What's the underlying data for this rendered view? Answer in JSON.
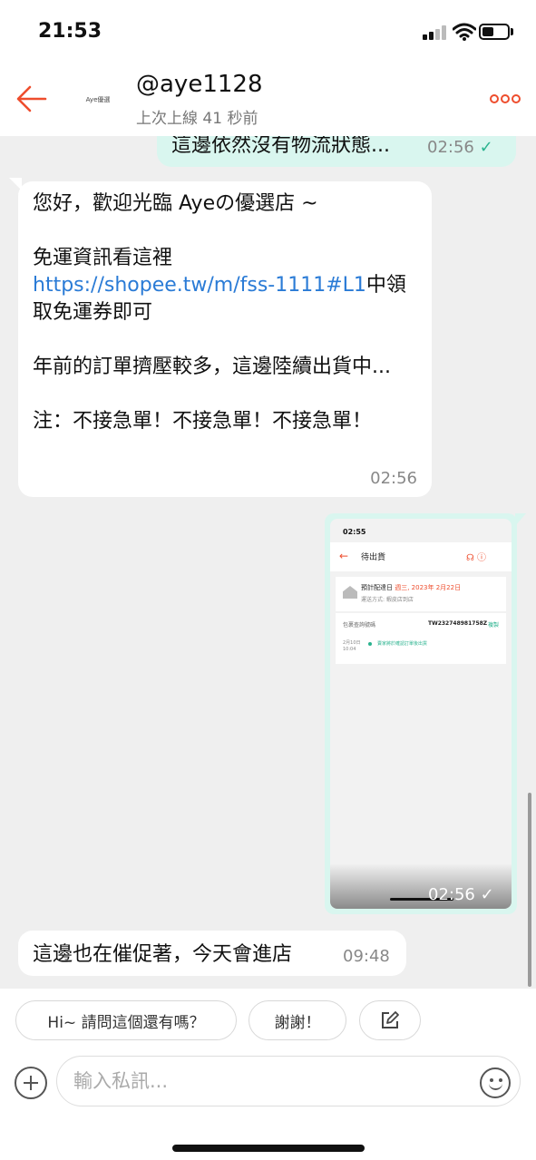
{
  "status_bar": {
    "time": "21:53"
  },
  "header": {
    "username": "@aye1128",
    "last_seen": "上次上線 41 秒前",
    "avatar_text": "Aye優選"
  },
  "messages": {
    "m1": {
      "text": "這邊依然沒有物流狀態...",
      "time": "02:56",
      "status": "✓"
    },
    "m2": {
      "p1": "您好，歡迎光臨 Ayeの優選店 ~",
      "p2_prefix": "免運資訊看這裡 ",
      "p2_link": "https://shopee.tw/m/fss-1111#L1",
      "p2_suffix": "中領取免運券即可",
      "p3": "年前的訂單擠壓較多，這邊陸續出貨中...",
      "p4": "注：不接急單！不接急單！不接急單！",
      "time": "02:56"
    },
    "m3": {
      "time": "02:56",
      "status": "✓",
      "screenshot": {
        "time": "02:55",
        "title": "待出貨",
        "delivery_label": "預計配達日",
        "delivery_date": "週三, 2023年 2月22日",
        "shipping_method": "運送方式: 蝦皮店到店",
        "tracking_label": "包裹查詢號碼",
        "tracking_no": "TW232748981758Z",
        "copy_label": "複製",
        "event_date": "2月10日",
        "event_time": "10:04",
        "event_text": "賣家將於確認訂單後出貨"
      }
    },
    "m4": {
      "text": "這邊也在催促著，今天會進店",
      "time": "09:48"
    }
  },
  "quick_replies": [
    "Hi~ 請問這個還有嗎？",
    "謝謝！"
  ],
  "input": {
    "placeholder": "輸入私訊..."
  },
  "colors": {
    "accent": "#ee4d2d",
    "outgoing_bubble": "#d9f6ef",
    "link": "#2a7bd6"
  }
}
